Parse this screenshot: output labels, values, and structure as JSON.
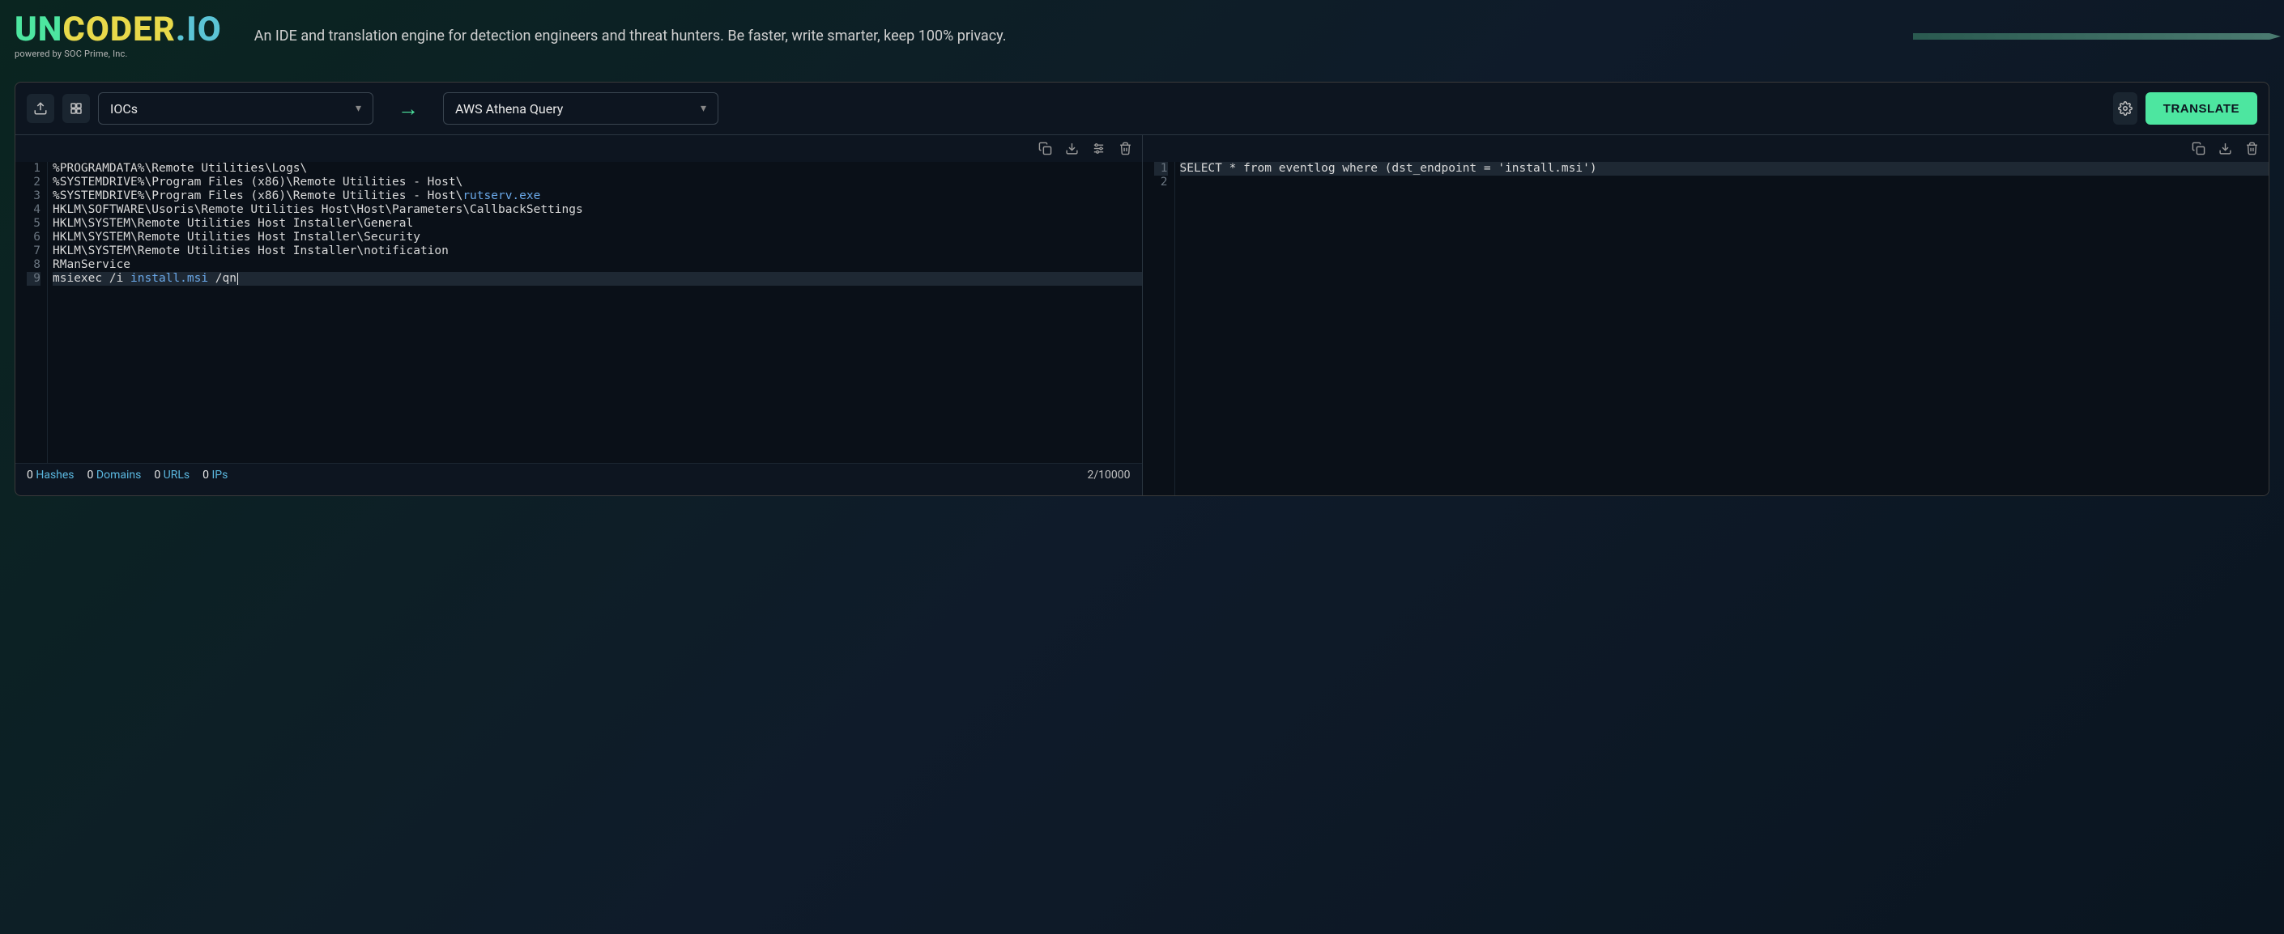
{
  "header": {
    "logo_un": "UN",
    "logo_coder": "CODER",
    "logo_io": ".IO",
    "powered": "powered by SOC Prime, Inc.",
    "tagline": "An IDE and translation engine for detection engineers and threat hunters. Be faster, write smarter, keep 100% privacy."
  },
  "controls": {
    "source_dropdown": "IOCs",
    "target_dropdown": "AWS Athena Query",
    "translate_label": "TRANSLATE"
  },
  "source_editor": {
    "lines": [
      {
        "n": "1",
        "text": "%PROGRAMDATA%\\Remote Utilities\\Logs\\"
      },
      {
        "n": "2",
        "text": "%SYSTEMDRIVE%\\Program Files (x86)\\Remote Utilities - Host\\"
      },
      {
        "n": "3",
        "prefix": "%SYSTEMDRIVE%\\Program Files (x86)\\Remote Utilities - Host\\",
        "file": "rutserv.exe"
      },
      {
        "n": "4",
        "text": "HKLM\\SOFTWARE\\Usoris\\Remote Utilities Host\\Host\\Parameters\\CallbackSettings"
      },
      {
        "n": "5",
        "text": "HKLM\\SYSTEM\\Remote Utilities Host Installer\\General"
      },
      {
        "n": "6",
        "text": "HKLM\\SYSTEM\\Remote Utilities Host Installer\\Security"
      },
      {
        "n": "7",
        "text": "HKLM\\SYSTEM\\Remote Utilities Host Installer\\notification"
      },
      {
        "n": "8",
        "text": "RManService"
      },
      {
        "n": "9",
        "prefix": "msiexec /i ",
        "file": "install.msi",
        "suffix": " /qn",
        "current": true
      }
    ]
  },
  "target_editor": {
    "lines": [
      {
        "n": "1",
        "text": "SELECT * from eventlog where (dst_endpoint = 'install.msi')",
        "current": true
      },
      {
        "n": "2",
        "text": ""
      }
    ]
  },
  "status": {
    "stats": [
      {
        "num": "0",
        "label": "Hashes"
      },
      {
        "num": "0",
        "label": "Domains"
      },
      {
        "num": "0",
        "label": "URLs"
      },
      {
        "num": "0",
        "label": "IPs"
      }
    ],
    "counter": "2/10000"
  }
}
